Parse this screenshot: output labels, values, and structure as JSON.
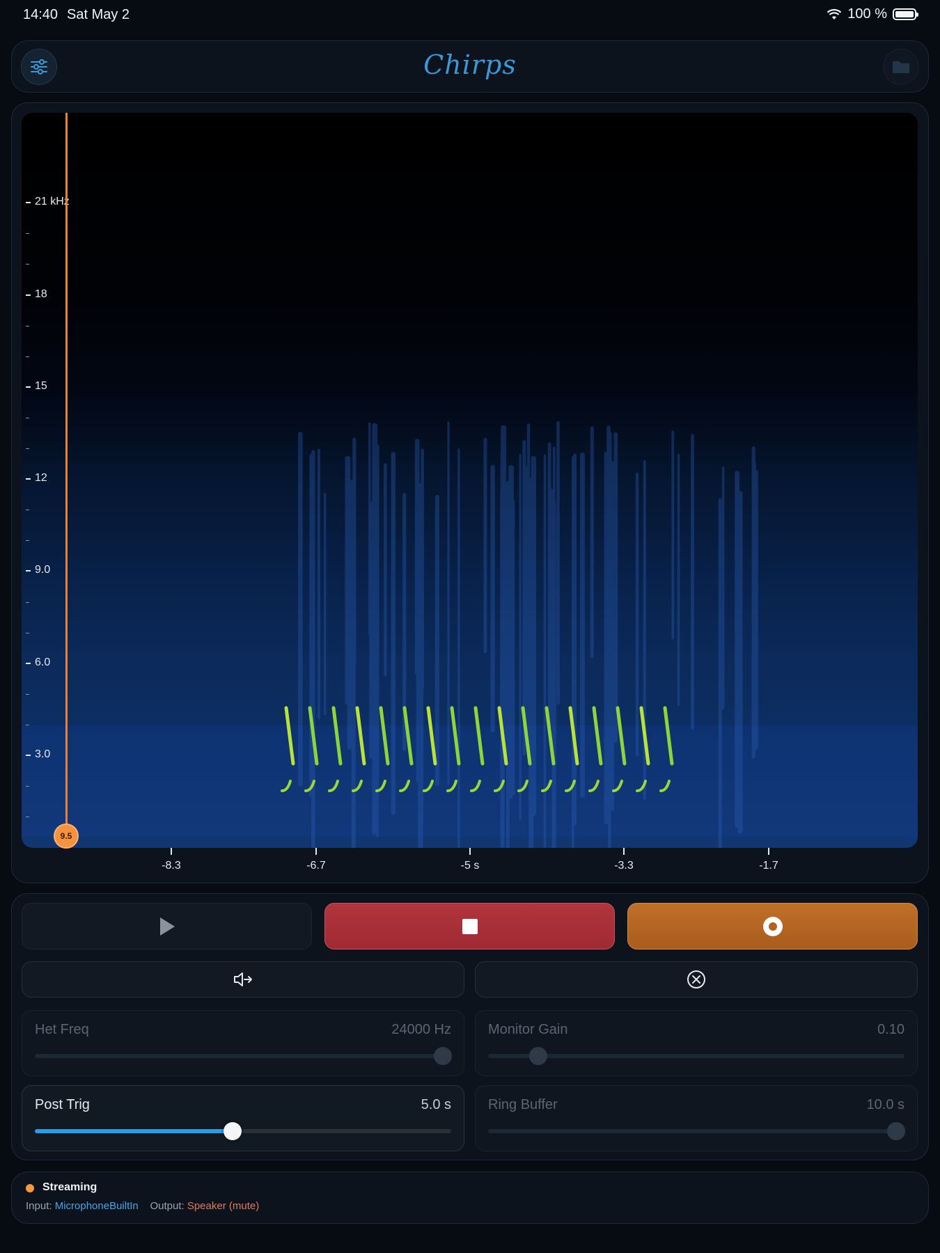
{
  "status_bar": {
    "time": "14:40",
    "date": "Sat May 2",
    "battery": "100 %"
  },
  "header": {
    "title": "Chirps",
    "left_icon": "sliders-icon",
    "right_icon": "folder-icon"
  },
  "spectrogram": {
    "y_axis": {
      "labels": [
        {
          "text": "21 kHz",
          "value": 21
        },
        {
          "text": "18",
          "value": 18
        },
        {
          "text": "15",
          "value": 15
        },
        {
          "text": "12",
          "value": 12
        },
        {
          "text": "9.0",
          "value": 9
        },
        {
          "text": "6.0",
          "value": 6
        },
        {
          "text": "3.0",
          "value": 3
        }
      ]
    },
    "x_axis": {
      "labels": [
        {
          "text": "-8.3",
          "value": -8.3
        },
        {
          "text": "-6.7",
          "value": -6.7
        },
        {
          "text": "-5 s",
          "value": -5
        },
        {
          "text": "-3.3",
          "value": -3.3
        },
        {
          "text": "-1.7",
          "value": -1.7
        }
      ]
    },
    "playhead_label": "9.5",
    "accent": "#f5923e"
  },
  "transport": {
    "play_icon": "play-icon",
    "stop_icon": "stop-icon",
    "record_icon": "record-icon"
  },
  "routing": {
    "route_icon": "speaker-output-icon",
    "clear_icon": "clear-x-icon"
  },
  "sliders": {
    "het_freq": {
      "label": "Het Freq",
      "value": "24000 Hz",
      "level": 0.98,
      "enabled": false
    },
    "monitor_gain": {
      "label": "Monitor Gain",
      "value": "0.10",
      "level": 0.12,
      "enabled": false
    },
    "post_trig": {
      "label": "Post Trig",
      "value": "5.0 s",
      "level": 0.475,
      "enabled": true
    },
    "ring_buffer": {
      "label": "Ring Buffer",
      "value": "10.0 s",
      "level": 0.98,
      "enabled": false
    }
  },
  "footer": {
    "status": "Streaming",
    "input_label": "Input:",
    "input_value": "MicrophoneBuiltIn",
    "output_label": "Output:",
    "output_value": "Speaker (mute)",
    "status_color": "#f59a3b"
  }
}
